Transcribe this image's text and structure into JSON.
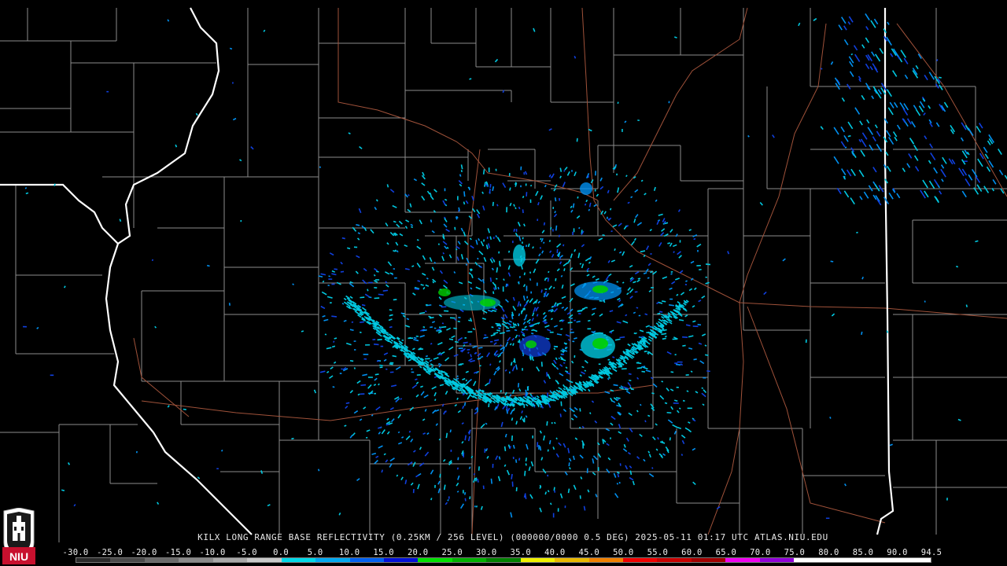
{
  "product_title": "KILX LONG RANGE BASE REFLECTIVITY (0.25KM / 256 LEVEL) (000000/0000 0.5 DEG) 2025-05-11 01:17 UTC  ATLAS.NIU.EDU",
  "logo": {
    "text": "NIU",
    "color": "#c8102e"
  },
  "colorbar": {
    "ticks": [
      "-30.0",
      "-25.0",
      "-20.0",
      "-15.0",
      "-10.0",
      "-5.0",
      "0.0",
      "5.0",
      "10.0",
      "15.0",
      "20.0",
      "25.0",
      "30.0",
      "35.0",
      "40.0",
      "45.0",
      "50.0",
      "55.0",
      "60.0",
      "65.0",
      "70.0",
      "75.0",
      "80.0",
      "85.0",
      "90.0",
      "94.5"
    ],
    "colors": [
      "#2a2a2a",
      "#4a4a4a",
      "#6a6a6a",
      "#8a8a8a",
      "#a8a8a8",
      "#c8c8c8",
      "#00d8e8",
      "#00a8f0",
      "#0060f0",
      "#0010d8",
      "#00e000",
      "#00b000",
      "#008000",
      "#f0f000",
      "#e8b800",
      "#f08000",
      "#f00000",
      "#c80000",
      "#a00000",
      "#f000f0",
      "#9000d8",
      "#ffffff",
      "#ffffff",
      "#ffffff",
      "#ffffff"
    ]
  },
  "map_colors": {
    "state_border": "#ffffff",
    "county_line": "#8c8c8c",
    "highway": "#a0523a",
    "echo_light": "#00c8e0",
    "echo_mid": "#0090f0",
    "echo_dark": "#1040e0",
    "echo_green": "#00d000"
  }
}
